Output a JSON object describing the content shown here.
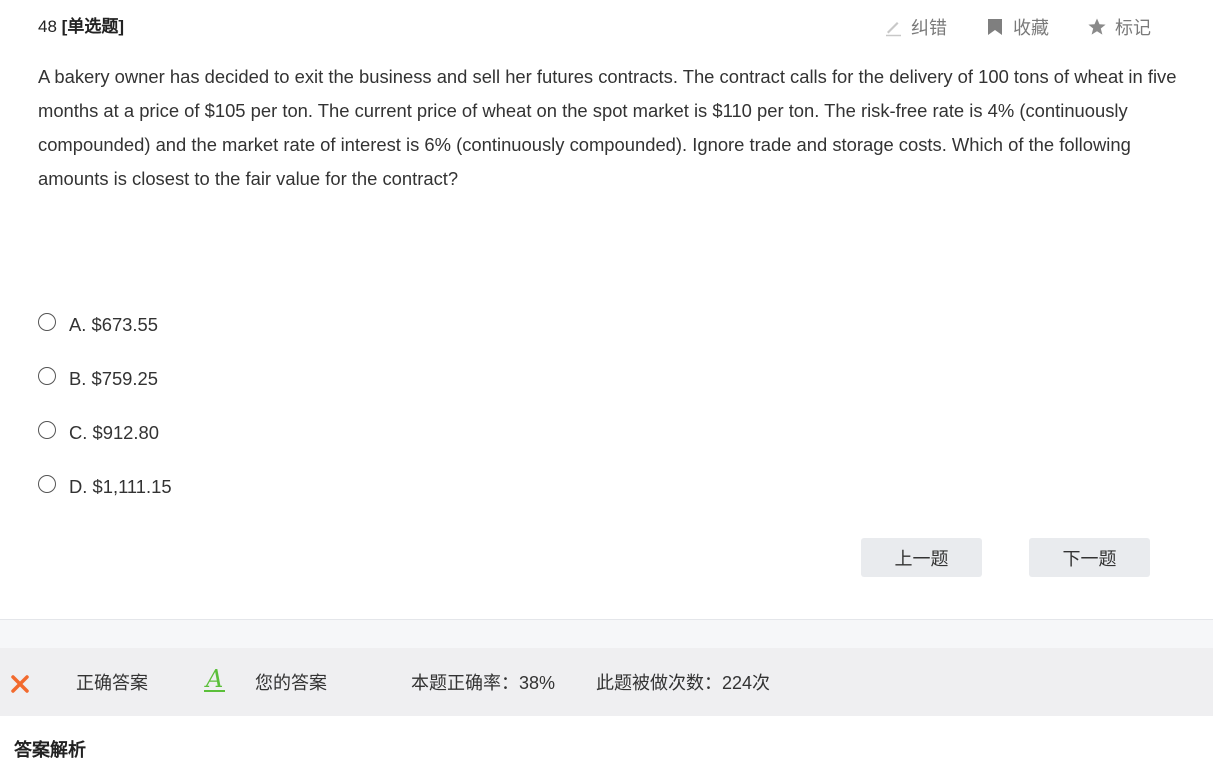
{
  "question": {
    "number": "48",
    "type_label": "[单选题]",
    "text": "A bakery owner has decided to exit the business and sell her futures contracts. The contract calls for the delivery of 100 tons of wheat in five months at a price of $105 per ton. The current price of wheat on the spot market is $110 per ton. The risk-free rate is 4% (continuously compounded) and the market rate of interest is 6% (continuously compounded). Ignore trade and storage costs. Which of the following amounts is closest to the fair value for the contract?"
  },
  "actions": {
    "report_error": "纠错",
    "favorite": "收藏",
    "mark": "标记",
    "icons": [
      "pencil-icon",
      "bookmark-icon",
      "star-icon"
    ]
  },
  "options": [
    {
      "label": "A. $673.55"
    },
    {
      "label": "B. $759.25"
    },
    {
      "label": "C. $912.80"
    },
    {
      "label": "D. $1,111.15"
    }
  ],
  "navigation": {
    "prev": "上一题",
    "next": "下一题"
  },
  "answer_bar": {
    "correct_answer_label": "正确答案",
    "your_answer_letter": "A",
    "your_answer_label": "您的答案",
    "accuracy": "本题正确率：38%",
    "attempts": "此题被做次数：224次",
    "colors": {
      "wrong": "#f26a2e",
      "your_answer": "#5bbf3a"
    }
  },
  "analysis": {
    "title": "答案解析"
  }
}
